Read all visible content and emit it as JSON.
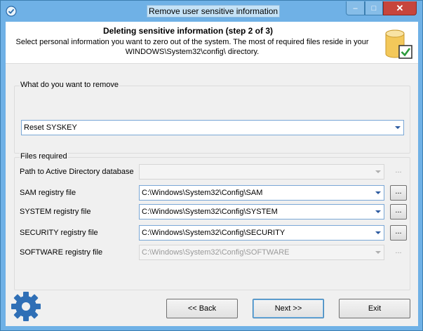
{
  "window": {
    "title": "Remove user sensitive information",
    "close_glyph": "✕",
    "maximize_glyph": "□",
    "minimize_glyph": "–"
  },
  "header": {
    "title": "Deleting sensitive information (step 2 of 3)",
    "description": "Select personal information you want to zero out of the system. The most of required files reside in your WINDOWS\\System32\\config\\ directory.",
    "icon": "database-check-icon"
  },
  "remove_group": {
    "label": "What do you want to remove",
    "selected": "Reset SYSKEY"
  },
  "files_group": {
    "label": "Files required",
    "rows": [
      {
        "label": "Path to Active Directory database",
        "value": "",
        "enabled": false,
        "browse": "..."
      },
      {
        "label": "SAM registry file",
        "value": "C:\\Windows\\System32\\Config\\SAM",
        "enabled": true,
        "browse": "..."
      },
      {
        "label": "SYSTEM registry file",
        "value": "C:\\Windows\\System32\\Config\\SYSTEM",
        "enabled": true,
        "browse": "..."
      },
      {
        "label": "SECURITY registry file",
        "value": "C:\\Windows\\System32\\Config\\SECURITY",
        "enabled": true,
        "browse": "..."
      },
      {
        "label": "SOFTWARE registry file",
        "value": "C:\\Windows\\System32\\Config\\SOFTWARE",
        "enabled": false,
        "browse": "..."
      }
    ]
  },
  "footer": {
    "back_label": "<< Back",
    "next_label": "Next >>",
    "exit_label": "Exit",
    "icon": "gear-icon"
  },
  "colors": {
    "titlebar": "#6fb1e6",
    "close": "#c7453c",
    "accent_border": "#7aa7d6",
    "gear": "#2f6fb6"
  }
}
